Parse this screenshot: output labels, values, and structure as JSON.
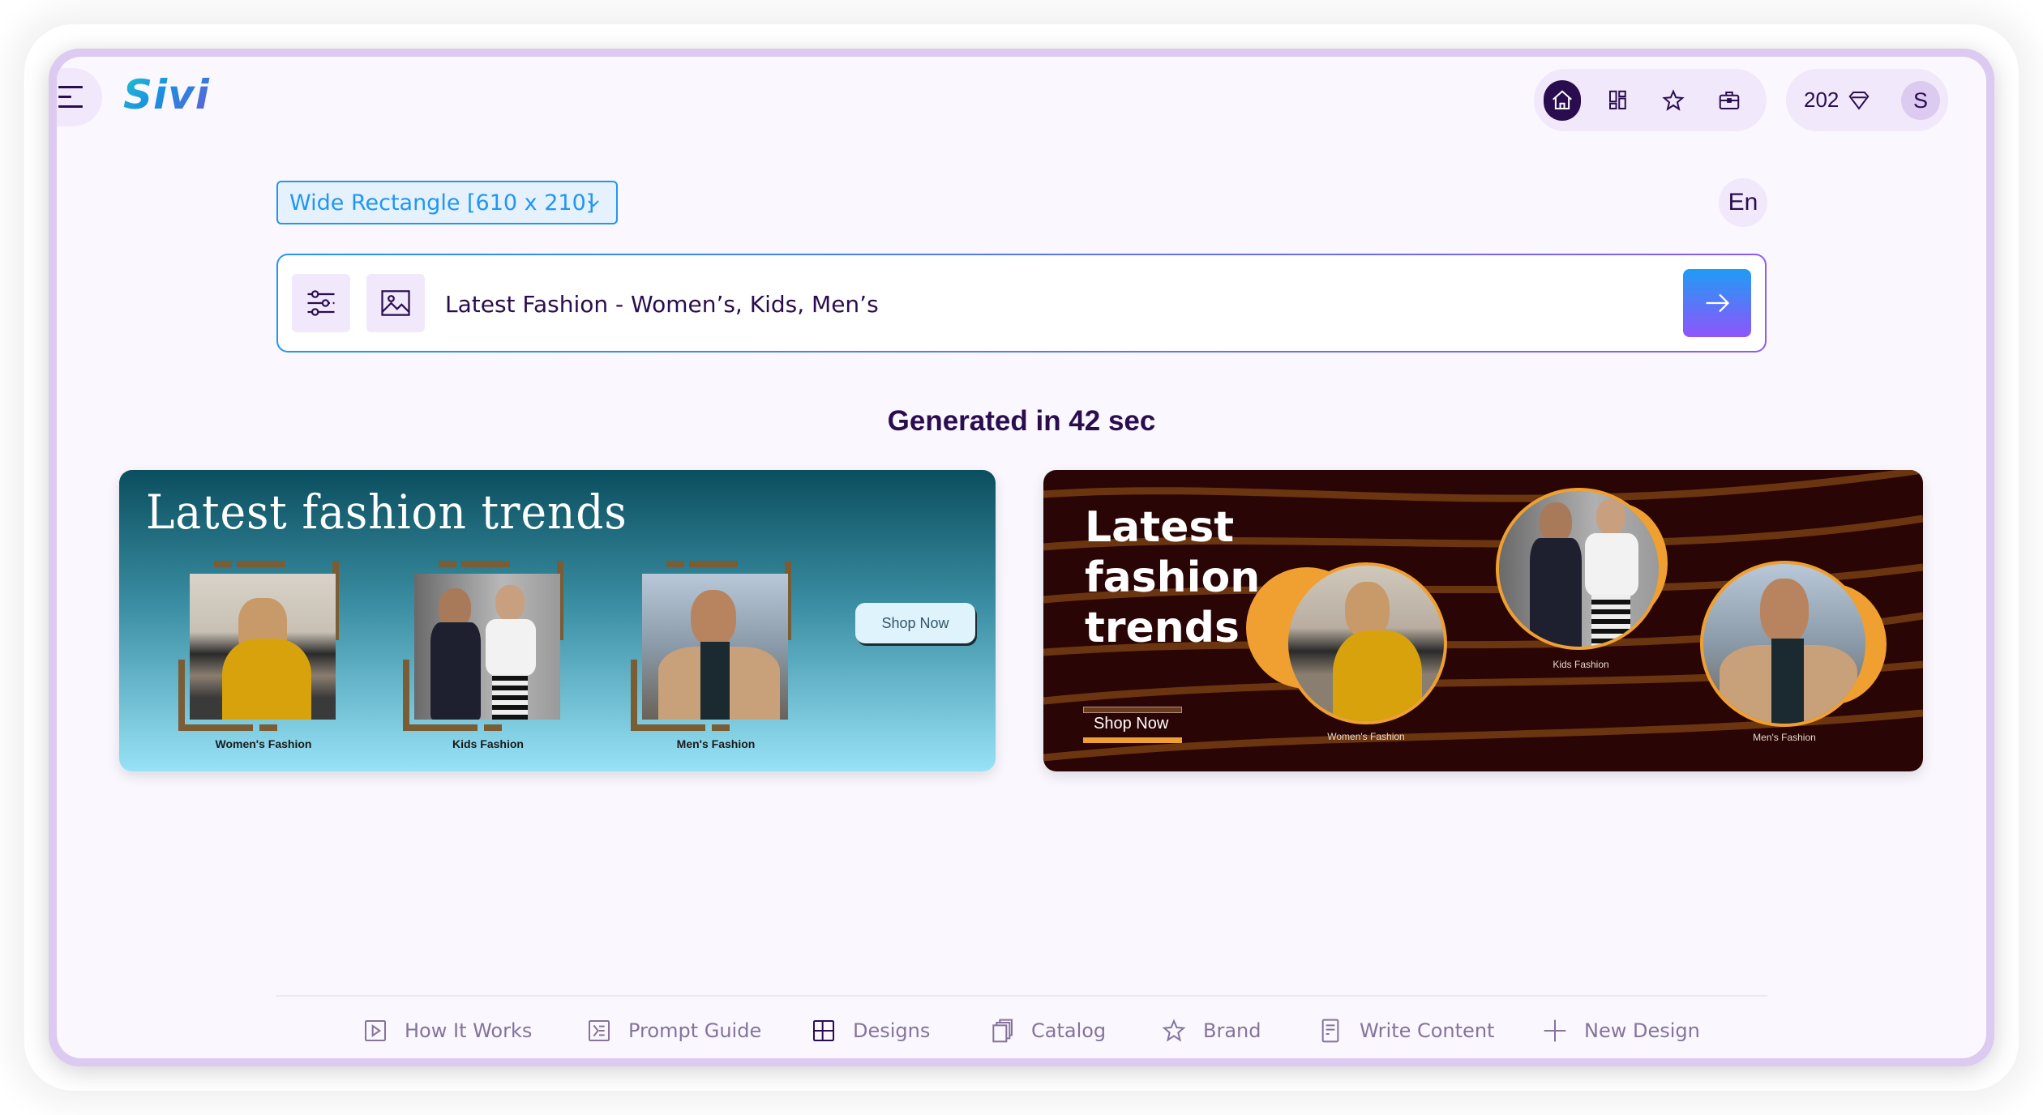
{
  "app": {
    "logo": "Sivi"
  },
  "header": {
    "nav_icons": [
      {
        "name": "home-icon",
        "label": "Home",
        "active": true
      },
      {
        "name": "dashboard-icon",
        "label": "Designs"
      },
      {
        "name": "star-icon",
        "label": "Favorites"
      },
      {
        "name": "briefcase-icon",
        "label": "Brand Kit"
      }
    ],
    "credits": "202",
    "credits_icon": "diamond-icon",
    "avatar_initial": "S"
  },
  "controls": {
    "size_select": "Wide Rectangle [610 x 210]",
    "language": "En"
  },
  "prompt": {
    "value": "Latest Fashion - Women’s, Kids, Men’s",
    "settings_icon": "sliders-icon",
    "image_icon": "image-icon",
    "send_icon": "arrow-right-icon"
  },
  "results": {
    "title": "Generated in 42 sec",
    "designs": [
      {
        "title": "Latest fashion trends",
        "cta": "Shop Now",
        "captions": [
          "Women's Fashion",
          "Kids Fashion",
          "Men's Fashion"
        ],
        "theme_colors": [
          "#0a4e5e",
          "#98e2f6",
          "#7a5c35"
        ]
      },
      {
        "title_lines": [
          "Latest",
          "fashion",
          "trends"
        ],
        "cta": "Shop Now",
        "captions": [
          "Women's Fashion",
          "Kids Fashion",
          "Men's Fashion"
        ],
        "theme_colors": [
          "#2a0505",
          "#f0a030",
          "#6b3a1a"
        ]
      }
    ]
  },
  "footer": {
    "items": [
      {
        "label": "How It Works",
        "icon": "play-icon"
      },
      {
        "label": "Prompt Guide",
        "icon": "prompt-guide-icon"
      },
      {
        "label": "Designs",
        "icon": "layout-icon"
      },
      {
        "label": "Catalog",
        "icon": "catalog-icon"
      },
      {
        "label": "Brand",
        "icon": "star-icon"
      },
      {
        "label": "Write Content",
        "icon": "document-icon"
      },
      {
        "label": "New Design",
        "icon": "plus-icon"
      }
    ]
  },
  "colors": {
    "brand_dark": "#2a0d4f",
    "accent_blue": "#2196f3",
    "accent_purple": "#8f55fb",
    "frame_lavender": "#dccaf0",
    "pill_bg": "#f1e8fb"
  }
}
